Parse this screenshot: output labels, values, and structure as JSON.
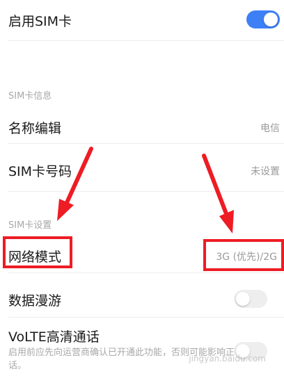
{
  "sim_enable": {
    "label": "启用SIM卡",
    "on": true
  },
  "sections": {
    "info": "SIM卡信息",
    "settings": "SIM卡设置"
  },
  "name_edit": {
    "label": "名称编辑",
    "value": "电信"
  },
  "sim_number": {
    "label": "SIM卡号码",
    "value": "未设置"
  },
  "network_mode": {
    "label": "网络模式",
    "value": "3G (优先)/2G"
  },
  "data_roaming": {
    "label": "数据漫游",
    "on": false
  },
  "volte": {
    "label": "VoLTE高清通话",
    "description": "启用前应先向运营商确认已开通此功能，否则可能影响正常通话。",
    "on": false
  },
  "watermark": "jingyan.baidu.com",
  "colors": {
    "accent": "#3d7ff5",
    "annotation": "#ee1c24"
  }
}
